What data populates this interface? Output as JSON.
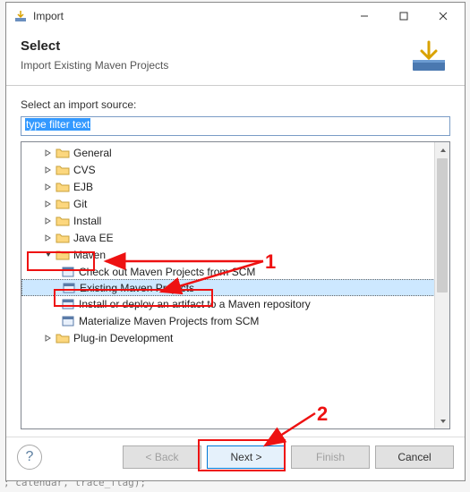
{
  "titlebar": {
    "title": "Import"
  },
  "header": {
    "select": "Select",
    "subtitle": "Import Existing Maven Projects"
  },
  "content": {
    "source_label": "Select an import source:",
    "filter_text": "type filter text"
  },
  "tree": {
    "items": [
      {
        "label": "General"
      },
      {
        "label": "CVS"
      },
      {
        "label": "EJB"
      },
      {
        "label": "Git"
      },
      {
        "label": "Install"
      },
      {
        "label": "Java EE"
      },
      {
        "label": "Maven",
        "expanded": true,
        "children": [
          {
            "label": "Check out Maven Projects from SCM"
          },
          {
            "label": "Existing Maven Projects",
            "selected": true
          },
          {
            "label": "Install or deploy an artifact to a Maven repository"
          },
          {
            "label": "Materialize Maven Projects from SCM"
          }
        ]
      },
      {
        "label": "Plug-in Development"
      }
    ]
  },
  "buttons": {
    "back": "< Back",
    "next": "Next >",
    "finish": "Finish",
    "cancel": "Cancel"
  },
  "annotations": {
    "num1": "1",
    "num2": "2"
  },
  "bg": {
    "line": ";  calendar, trace_flag);"
  }
}
